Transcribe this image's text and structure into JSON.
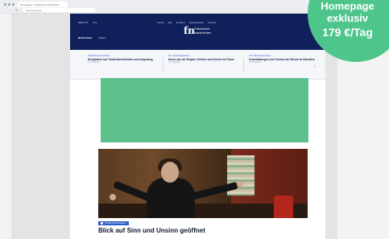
{
  "browser": {
    "tab_label": "Homepage - Fränkische Nachrichten",
    "url": "www.fnweb.de",
    "back_glyph": "←",
    "forward_glyph": "→",
    "reload_glyph": "↻"
  },
  "header": {
    "top_left": [
      "MEIN FN",
      "Abo"
    ],
    "top_links": [
      "Suche",
      "Abo",
      "E-Paper",
      "Gewinnspiele",
      "Kontakt"
    ],
    "logo_mark": "fn",
    "logo_line1": "Fränkische",
    "logo_line2": "Nachrichten",
    "nav": [
      "Nachrichten",
      "Videos"
    ]
  },
  "teasers": [
    {
      "kicker": "Fränkische Nachrichten",
      "title": "Neuigkeiten aus Tauberbischofsheim und Umgebung",
      "meta": "vor 2 Stunden"
    },
    {
      "kicker": "FN • Bad Mergentheim",
      "title": "Neues aus der Region: Schulen und Vereine im Fokus",
      "meta": "vor 3 Stunden"
    },
    {
      "kicker": "FN • Main-Tauber-Kreis",
      "title": "Veranstaltungen und Termine der Woche im Überblick",
      "meta": "vor 5 Stunden"
    }
  ],
  "article": {
    "badge": "Tauberbischofsheim",
    "headline": "Blick auf Sinn und Unsinn geöffnet"
  },
  "promo": {
    "line1": "Homepage",
    "line2": "exklusiv",
    "line3": "179 €/Tag",
    "color": "#4ec58b"
  },
  "colors": {
    "header_bg": "#10205a",
    "ad_bg": "#5ec08a",
    "accent": "#2b5bc7"
  }
}
